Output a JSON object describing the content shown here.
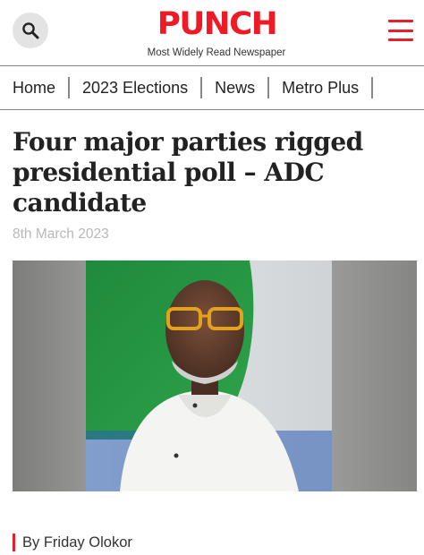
{
  "header": {
    "logo_text": "PUNCH",
    "tagline": "Most Widely Read Newspaper",
    "search_icon": "search-icon",
    "menu_icon": "hamburger-menu-icon"
  },
  "nav": {
    "items": [
      {
        "label": "Home"
      },
      {
        "label": "2023 Elections"
      },
      {
        "label": "News"
      },
      {
        "label": "Metro Plus"
      }
    ]
  },
  "article": {
    "headline": "Four major parties rigged presidential poll – ADC candidate",
    "date": "8th March 2023",
    "byline": "By Friday Olokor"
  },
  "colors": {
    "brand_red": "#ef1a26",
    "accent_red": "#e5202b",
    "date_gray": "#b8b8b8"
  }
}
